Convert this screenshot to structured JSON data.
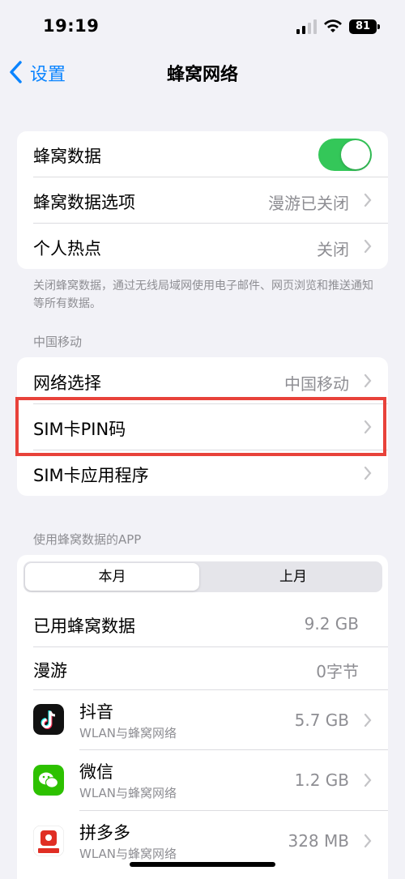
{
  "status_bar": {
    "time": "19:19",
    "battery": "81"
  },
  "nav": {
    "back_label": "设置",
    "title": "蜂窝网络"
  },
  "group1": {
    "cellular_data_label": "蜂窝数据",
    "cellular_data_on": true,
    "options_label": "蜂窝数据选项",
    "options_value": "漫游已关闭",
    "hotspot_label": "个人热点",
    "hotspot_value": "关闭",
    "note": "关闭蜂窝数据，通过无线局域网使用电子邮件、网页浏览和推送通知等所有数据。"
  },
  "group2": {
    "header": "中国移动",
    "network_label": "网络选择",
    "network_value": "中国移动",
    "pin_label": "SIM卡PIN码",
    "sim_apps_label": "SIM卡应用程序"
  },
  "group3": {
    "header": "使用蜂窝数据的APP",
    "seg_current": "本月",
    "seg_last": "上月",
    "used_label": "已用蜂窝数据",
    "used_value": "9.2 GB",
    "roaming_label": "漫游",
    "roaming_value": "0字节",
    "apps": [
      {
        "name": "抖音",
        "sub": "WLAN与蜂窝网络",
        "size": "5.7 GB",
        "icon": "douyin-icon"
      },
      {
        "name": "微信",
        "sub": "WLAN与蜂窝网络",
        "size": "1.2 GB",
        "icon": "wechat-icon"
      },
      {
        "name": "拼多多",
        "sub": "WLAN与蜂窝网络",
        "size": "328 MB",
        "icon": "pinduoduo-icon"
      }
    ]
  },
  "colors": {
    "accent": "#0a84ff",
    "toggle_on": "#34c759",
    "highlight": "#e8423a"
  }
}
